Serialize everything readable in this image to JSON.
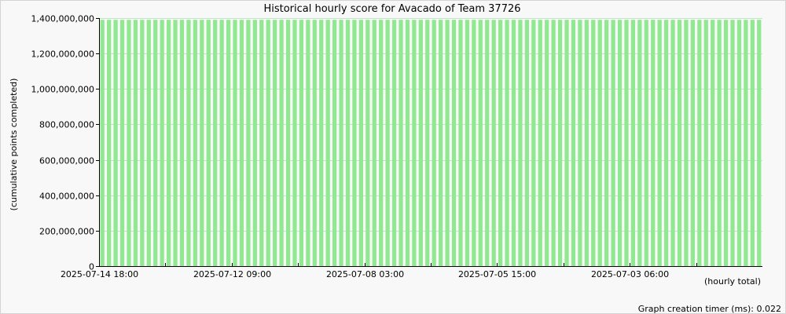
{
  "chart_data": {
    "type": "bar",
    "title": "Historical hourly score for Avacado of Team 37726",
    "ylabel": "(cumulative points completed)",
    "xlabel": "(hourly total)",
    "ylim": [
      0,
      1400000000
    ],
    "yticks": [
      {
        "value": 0,
        "label": "0"
      },
      {
        "value": 200000000,
        "label": "200,000,000"
      },
      {
        "value": 400000000,
        "label": "400,000,000"
      },
      {
        "value": 600000000,
        "label": "600,000,000"
      },
      {
        "value": 800000000,
        "label": "800,000,000"
      },
      {
        "value": 1000000000,
        "label": "1,000,000,000"
      },
      {
        "value": 1200000000,
        "label": "1,200,000,000"
      },
      {
        "value": 1400000000,
        "label": "1,400,000,000"
      }
    ],
    "xtick_labels": [
      {
        "index": 0,
        "label": "2025-07-14 18:00"
      },
      {
        "index": 20,
        "label": "2025-07-12 09:00"
      },
      {
        "index": 40,
        "label": "2025-07-08 03:00"
      },
      {
        "index": 60,
        "label": "2025-07-05 15:00"
      },
      {
        "index": 80,
        "label": "2025-07-03 06:00"
      }
    ],
    "minor_tick_indices": [
      10,
      30,
      50,
      70,
      90
    ],
    "bar_count": 100,
    "bar_value": 1390000000,
    "bar_color": "#90e890",
    "grid": true,
    "grid_color": "#c0e8c0"
  },
  "footer": {
    "timer_text": "Graph creation timer (ms): 0.022"
  }
}
